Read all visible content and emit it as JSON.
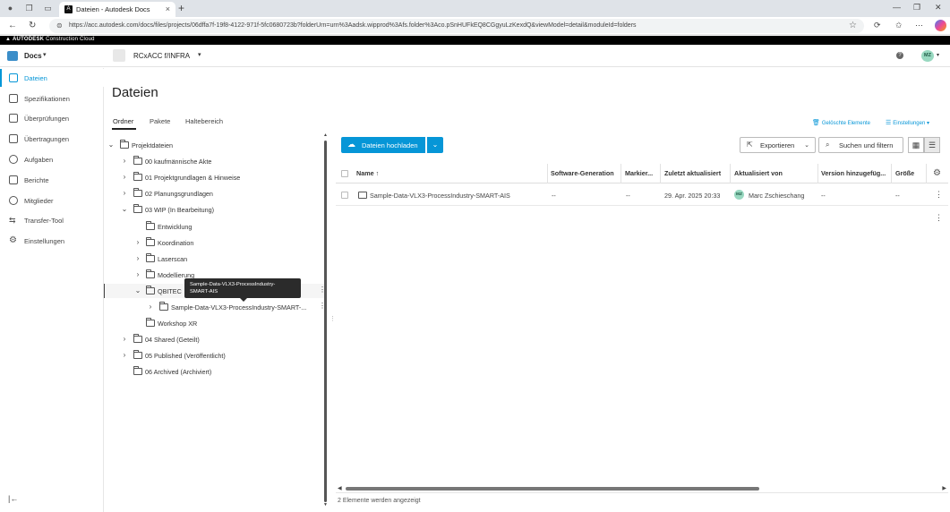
{
  "browser": {
    "tab_title": "Dateien - Autodesk Docs",
    "url": "https://acc.autodesk.com/docs/files/projects/06dffa7f-19f8-4122-971f-5fc0680723b?folderUrn=urn%3Aadsk.wipprod%3Afs.folder%3Aco.pSnHUFkEQ8CGgyuLzKexdQ&viewModel=detail&moduleId=folders"
  },
  "app": {
    "brand_prefix": "AUTODESK",
    "brand_suffix": "Construction Cloud",
    "module": "Docs",
    "project": "RCxACC f/INFRA",
    "user_initials": "MZ"
  },
  "leftnav": {
    "items": [
      {
        "label": "Dateien",
        "icon": "file-icon"
      },
      {
        "label": "Spezifikationen",
        "icon": "spec-icon"
      },
      {
        "label": "Überprüfungen",
        "icon": "review-icon"
      },
      {
        "label": "Übertragungen",
        "icon": "transmittal-icon"
      },
      {
        "label": "Aufgaben",
        "icon": "check-circle-icon"
      },
      {
        "label": "Berichte",
        "icon": "report-icon"
      },
      {
        "label": "Mitglieder",
        "icon": "members-icon"
      },
      {
        "label": "Transfer-Tool",
        "icon": "transfer-icon"
      },
      {
        "label": "Einstellungen",
        "icon": "gear-icon"
      }
    ]
  },
  "page": {
    "title": "Dateien",
    "tabs": [
      "Ordner",
      "Pakete",
      "Haltebereich"
    ],
    "links": {
      "deleted": "Gelöschte Elemente",
      "settings": "Einstellungen"
    }
  },
  "tree": {
    "items": [
      {
        "label": "Projektdateien"
      },
      {
        "label": "00 kaufmännische Akte"
      },
      {
        "label": "01 Projektgrundlagen & Hinweise"
      },
      {
        "label": "02 Planungsgrundlagen"
      },
      {
        "label": "03 WIP (In Bearbeitung)"
      },
      {
        "label": "Entwicklung"
      },
      {
        "label": "Koordination"
      },
      {
        "label": "Laserscan"
      },
      {
        "label": "Modellierung"
      },
      {
        "label": "QBITEC"
      },
      {
        "label": "Sample-Data-VLX3-ProcessIndustry-SMART-..."
      },
      {
        "label": "Workshop XR"
      },
      {
        "label": "04 Shared (Geteilt)"
      },
      {
        "label": "05 Published (Veröffentlicht)"
      },
      {
        "label": "06 Archived (Archiviert)"
      }
    ],
    "tooltip_line1": "Sample-Data-VLX3-ProcessIndustry-",
    "tooltip_line2": "SMART-AIS"
  },
  "toolbar": {
    "upload": "Dateien hochladen",
    "export": "Exportieren",
    "search": "Suchen und filtern"
  },
  "table": {
    "headers": [
      "Name",
      "Software-Generation",
      "Markier...",
      "Zuletzt aktualisiert",
      "Aktualisiert von",
      "Version hinzugefüg...",
      "Größe"
    ],
    "rows": [
      {
        "name": "Sample-Data-VLX3-ProcessIndustry-SMART-AIS",
        "software": "--",
        "marked": "--",
        "updated": "29. Apr. 2025 20:33",
        "by_initials": "MZ",
        "by": "Marc Zschieschang",
        "version": "--",
        "size": "--"
      }
    ],
    "footer": "2 Elemente werden angezeigt"
  },
  "colors": {
    "accent": "#0696d7",
    "avatar": "#98d8c0"
  }
}
